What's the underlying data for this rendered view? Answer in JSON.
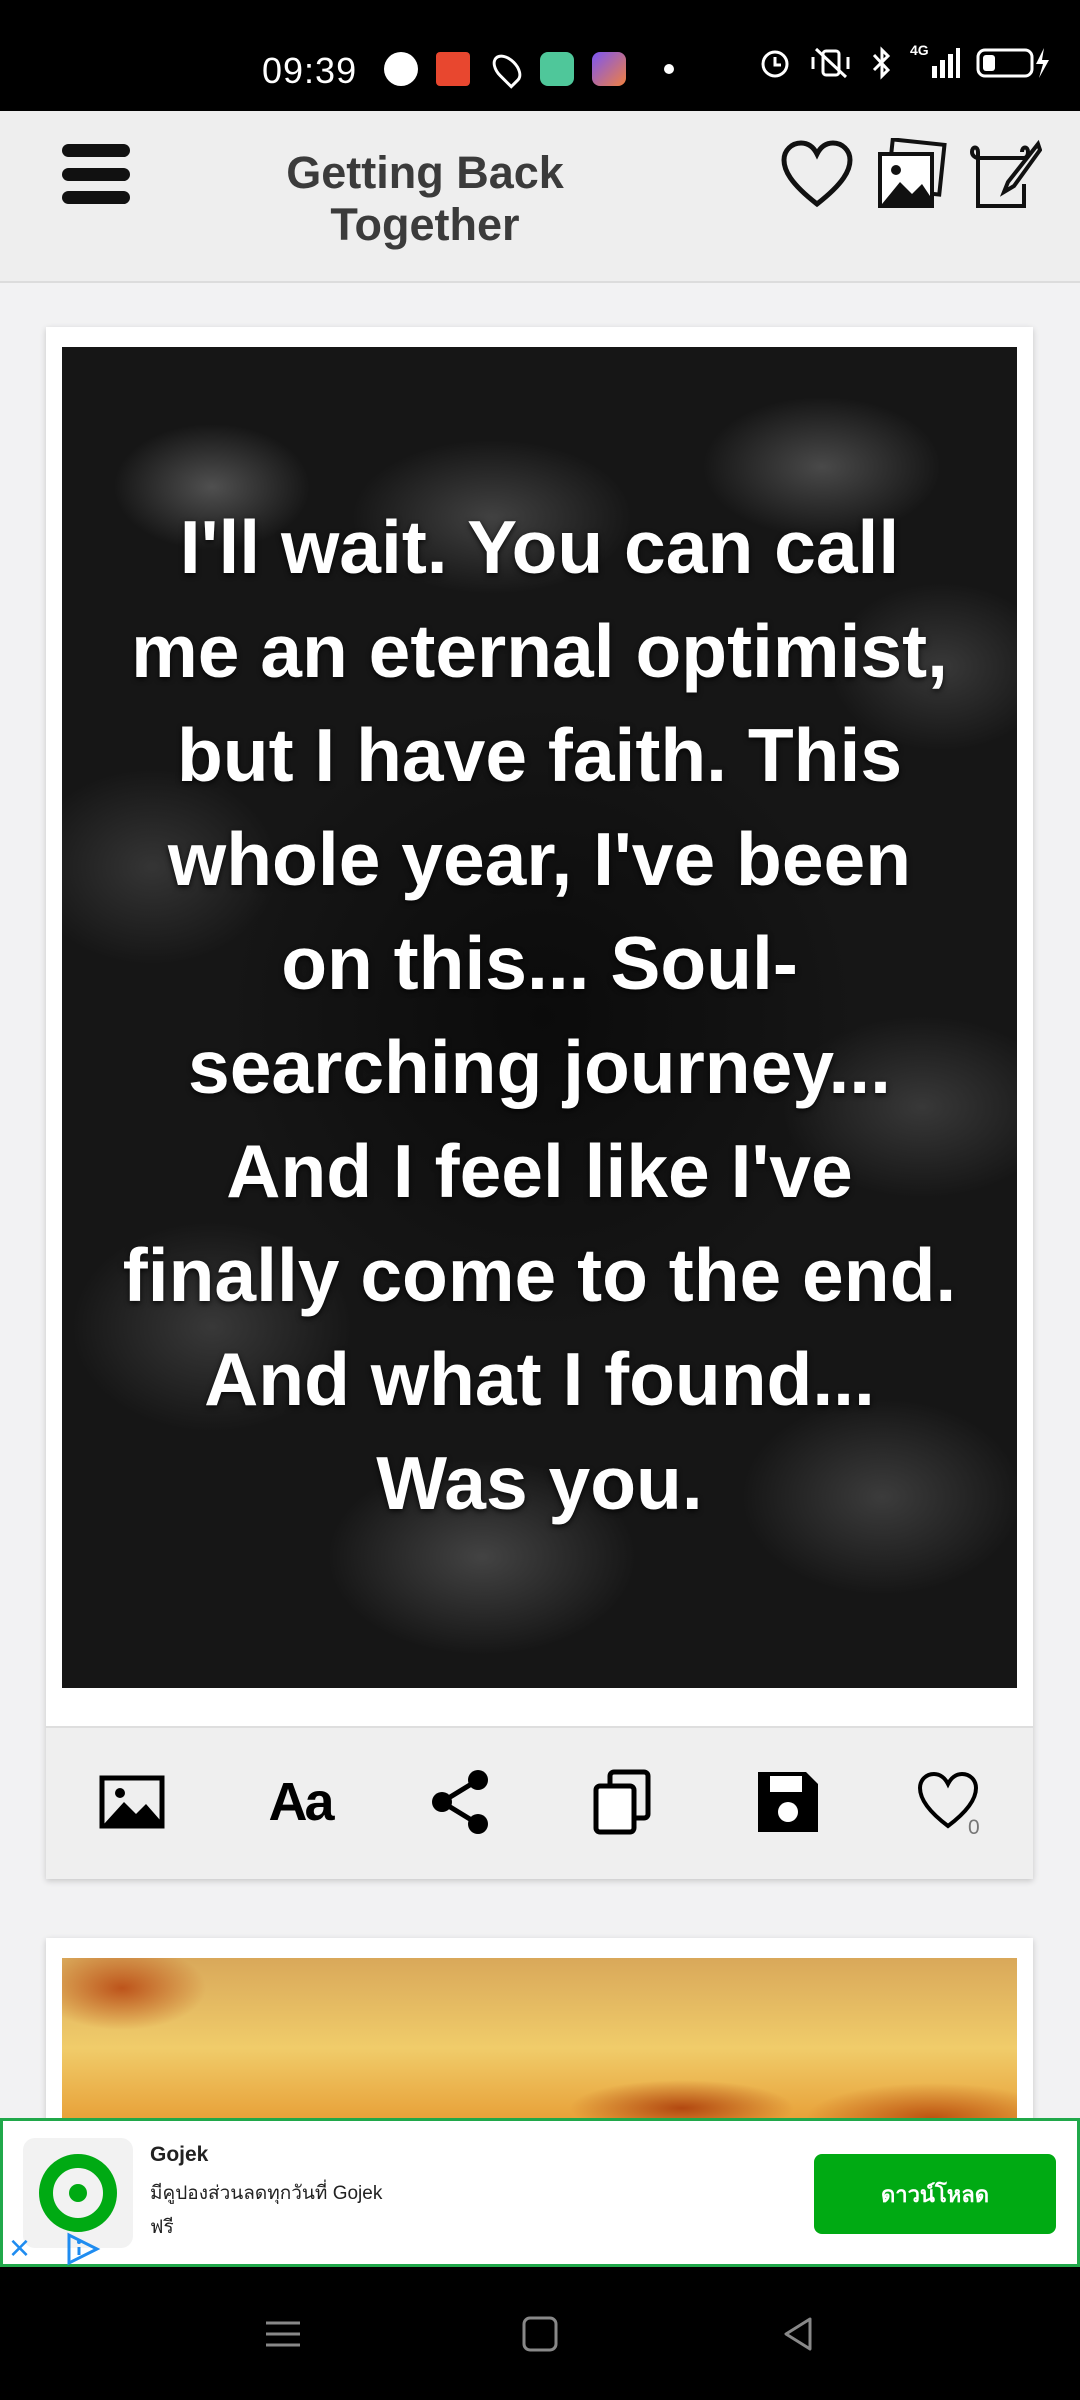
{
  "status_bar": {
    "time": "09:39",
    "network_label": "4G"
  },
  "app_bar": {
    "title": "Getting Back Together",
    "menu_icon": "hamburger-menu-icon",
    "actions": [
      "favorites-heart-icon",
      "photo-gallery-icon",
      "compose-quote-icon"
    ]
  },
  "quote_card": {
    "quote": "I'll wait. You can call me an eternal optimist, but I have faith. This whole year, I've been on this... Soul-searching journey... And I feel like I've finally come to the end. And what I found... Was you.",
    "text_tool_label": "Aa",
    "like_count": "0",
    "tools": [
      "image-background-icon",
      "font-text-icon",
      "share-icon",
      "copy-icon",
      "save-icon",
      "like-heart-icon"
    ]
  },
  "ad": {
    "brand": "Gojek",
    "description": "มีคูปองส่วนลดทุกวันที่ Gojek",
    "price": "ฟรี",
    "cta_label": "ดาวน์โหลด",
    "accent_color": "#00aa13"
  },
  "colors": {
    "app_bar_bg": "#eeeeee",
    "page_bg": "#f2f2f3",
    "title_color": "#3b3b3b"
  }
}
